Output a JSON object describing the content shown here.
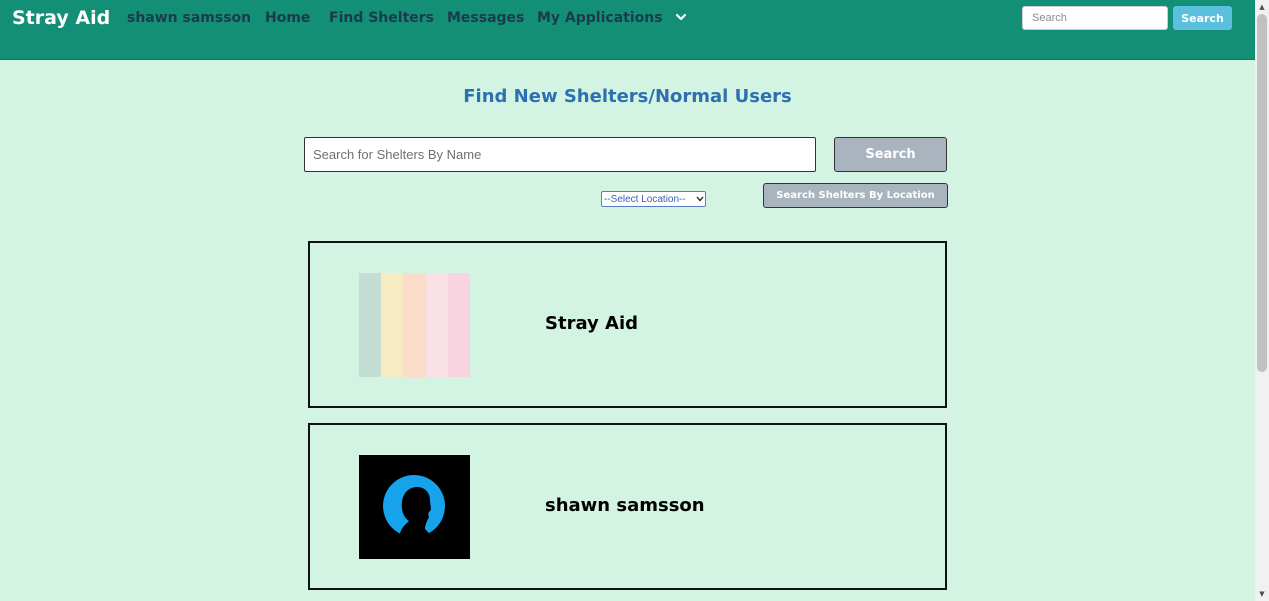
{
  "navbar": {
    "brand": "Stray Aid",
    "user_name": "shawn samsson",
    "links": [
      "Home",
      "Find Shelters",
      "Messages",
      "My Applications"
    ],
    "dropdown_icon": "chevron-down-icon",
    "search_placeholder": "Search",
    "search_button": "Search",
    "background_color": "#138f76",
    "search_button_color": "#5bc0de"
  },
  "main": {
    "title": "Find New Shelters/Normal Users",
    "search_placeholder": "Search for Shelters By Name",
    "search_button": "Search",
    "location_select": "--Select Location--",
    "location_button": "Search Shelters By Location",
    "title_color": "#2e6fb0",
    "background_color": "#d4f4e3"
  },
  "results": [
    {
      "name": "Stray Aid",
      "image": "pastel-stripes-logo",
      "stripe_colors": [
        "#c3dcd4",
        "#f7ebc2",
        "#fadcc9",
        "#f9e1e5",
        "#f8d3e0"
      ]
    },
    {
      "name": "shawn samsson",
      "image": "user-silhouette-avatar",
      "avatar_colors": {
        "background": "#000000",
        "ring": "#17a3ec"
      }
    }
  ]
}
